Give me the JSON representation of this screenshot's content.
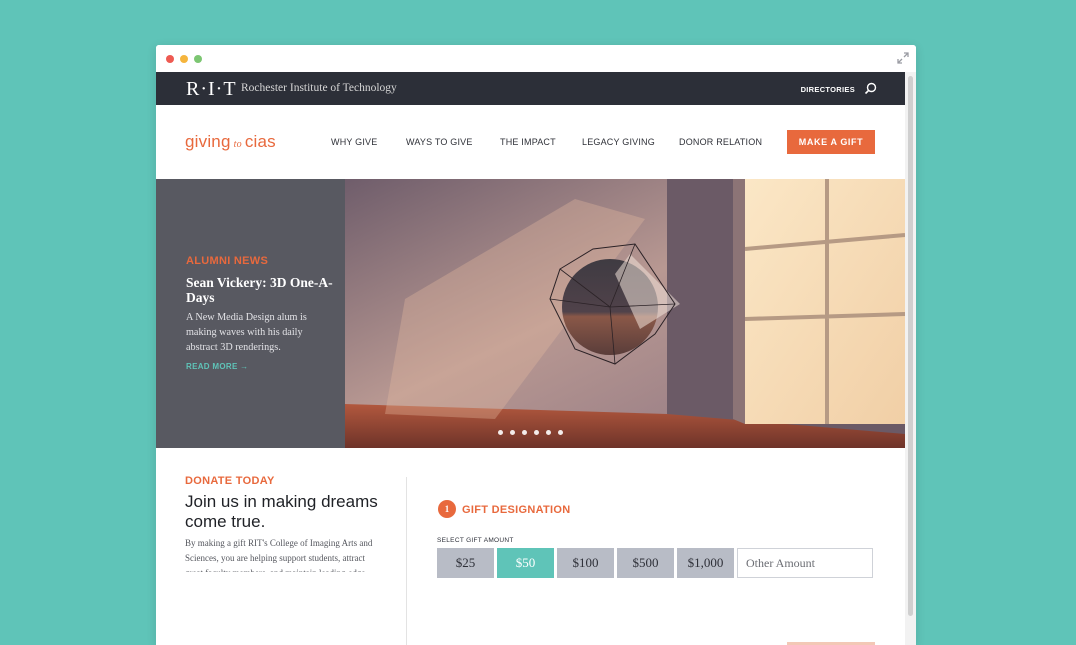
{
  "colors": {
    "accent": "#e8693d",
    "teal": "#5fc4b8",
    "dark": "#2c2f38"
  },
  "topbar": {
    "logo": "R·I·T",
    "institution": "Rochester Institute of Technology",
    "directories": "DIRECTORIES"
  },
  "nav": {
    "logo_left": "giving",
    "logo_mid": "to",
    "logo_right": "cias",
    "items": [
      "WHY GIVE",
      "WAYS TO GIVE",
      "THE IMPACT",
      "LEGACY GIVING",
      "DONOR RELATION"
    ],
    "cta": "MAKE A GIFT"
  },
  "hero": {
    "kicker": "ALUMNI NEWS",
    "title": "Sean Vickery: 3D One-A-Days",
    "description": "A New Media Design alum is making waves with his daily abstract 3D renderings.",
    "link": "READ MORE →",
    "slide_count": 6,
    "active_slide": 1
  },
  "donate": {
    "kicker": "DONATE TODAY",
    "headline": "Join us in making dreams come true.",
    "body": "By making a gift RIT's College of Imaging Arts and Sciences, you are helping support students, attract great faculty members, and maintain leading-edge academic programs.",
    "step_number": "1",
    "step_title": "GIFT DESIGNATION",
    "amount_label": "SELECT GIFT AMOUNT",
    "amounts": [
      "$25",
      "$50",
      "$100",
      "$500",
      "$1,000"
    ],
    "selected_amount": "$50",
    "other_placeholder": "Other Amount"
  }
}
